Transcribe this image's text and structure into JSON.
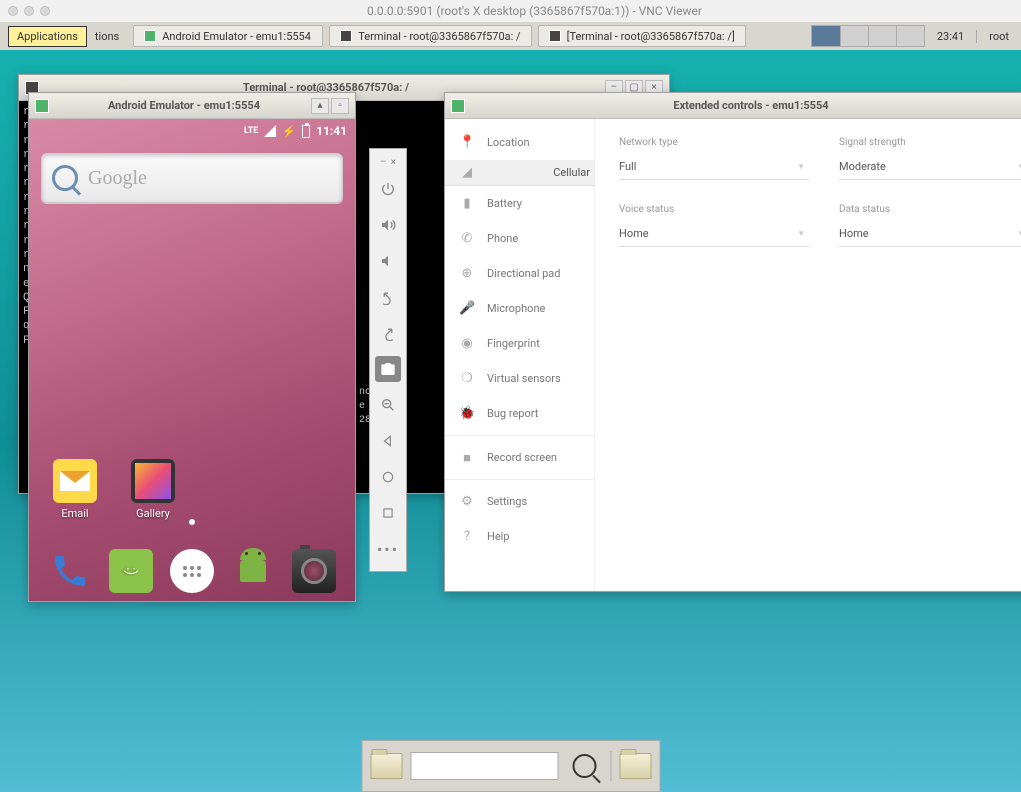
{
  "mac_title": "0.0.0.0:5901 (root's X desktop (3365867f570a:1)) - VNC Viewer",
  "taskbar": {
    "applications": "Applications",
    "applications_suffix": "tions",
    "task1": "Android Emulator - emu1:5554",
    "task2": "Terminal - root@3365867f570a: /",
    "task3": "[Terminal - root@3365867f570a: /]",
    "clock": "23:41",
    "user": "root"
  },
  "terminal_window": {
    "title": "Terminal - root@3365867f570a: /",
    "visible_chars": "r\nr\nr\nr\nr\nr\nr\nr\nr\nr\nr\nn\ne\nQ\nF\nq\nF"
  },
  "emulator_window": {
    "title": "Android Emulator - emu1:5554",
    "status_lte": "LTE",
    "status_time": "11:41",
    "search_placeholder": "Google",
    "apps": {
      "email": "Email",
      "gallery": "Gallery"
    }
  },
  "behind_text": "nc\ne\n\n28",
  "emu_toolbar": {
    "min": "–",
    "close": "×",
    "icons": [
      "power",
      "vol-up",
      "vol-down",
      "rotate-left",
      "rotate-right",
      "camera",
      "zoom-in",
      "back",
      "overview",
      "home",
      "more"
    ]
  },
  "extended": {
    "title": "Extended controls - emu1:5554",
    "nav": [
      "Location",
      "Cellular",
      "Battery",
      "Phone",
      "Directional pad",
      "Microphone",
      "Fingerprint",
      "Virtual sensors",
      "Bug report",
      "Record screen",
      "Settings",
      "Help"
    ],
    "fields": {
      "network_type": {
        "label": "Network type",
        "value": "Full"
      },
      "signal_strength": {
        "label": "Signal strength",
        "value": "Moderate"
      },
      "voice_status": {
        "label": "Voice status",
        "value": "Home"
      },
      "data_status": {
        "label": "Data status",
        "value": "Home"
      }
    }
  }
}
